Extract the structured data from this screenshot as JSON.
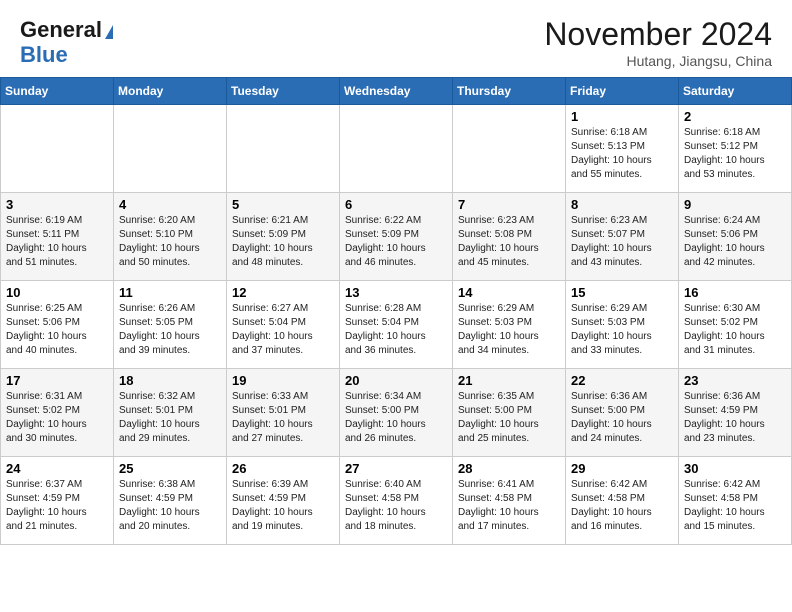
{
  "header": {
    "logo_line1": "General",
    "logo_line2": "Blue",
    "month": "November 2024",
    "location": "Hutang, Jiangsu, China"
  },
  "weekdays": [
    "Sunday",
    "Monday",
    "Tuesday",
    "Wednesday",
    "Thursday",
    "Friday",
    "Saturday"
  ],
  "weeks": [
    [
      {
        "day": "",
        "info": ""
      },
      {
        "day": "",
        "info": ""
      },
      {
        "day": "",
        "info": ""
      },
      {
        "day": "",
        "info": ""
      },
      {
        "day": "",
        "info": ""
      },
      {
        "day": "1",
        "info": "Sunrise: 6:18 AM\nSunset: 5:13 PM\nDaylight: 10 hours\nand 55 minutes."
      },
      {
        "day": "2",
        "info": "Sunrise: 6:18 AM\nSunset: 5:12 PM\nDaylight: 10 hours\nand 53 minutes."
      }
    ],
    [
      {
        "day": "3",
        "info": "Sunrise: 6:19 AM\nSunset: 5:11 PM\nDaylight: 10 hours\nand 51 minutes."
      },
      {
        "day": "4",
        "info": "Sunrise: 6:20 AM\nSunset: 5:10 PM\nDaylight: 10 hours\nand 50 minutes."
      },
      {
        "day": "5",
        "info": "Sunrise: 6:21 AM\nSunset: 5:09 PM\nDaylight: 10 hours\nand 48 minutes."
      },
      {
        "day": "6",
        "info": "Sunrise: 6:22 AM\nSunset: 5:09 PM\nDaylight: 10 hours\nand 46 minutes."
      },
      {
        "day": "7",
        "info": "Sunrise: 6:23 AM\nSunset: 5:08 PM\nDaylight: 10 hours\nand 45 minutes."
      },
      {
        "day": "8",
        "info": "Sunrise: 6:23 AM\nSunset: 5:07 PM\nDaylight: 10 hours\nand 43 minutes."
      },
      {
        "day": "9",
        "info": "Sunrise: 6:24 AM\nSunset: 5:06 PM\nDaylight: 10 hours\nand 42 minutes."
      }
    ],
    [
      {
        "day": "10",
        "info": "Sunrise: 6:25 AM\nSunset: 5:06 PM\nDaylight: 10 hours\nand 40 minutes."
      },
      {
        "day": "11",
        "info": "Sunrise: 6:26 AM\nSunset: 5:05 PM\nDaylight: 10 hours\nand 39 minutes."
      },
      {
        "day": "12",
        "info": "Sunrise: 6:27 AM\nSunset: 5:04 PM\nDaylight: 10 hours\nand 37 minutes."
      },
      {
        "day": "13",
        "info": "Sunrise: 6:28 AM\nSunset: 5:04 PM\nDaylight: 10 hours\nand 36 minutes."
      },
      {
        "day": "14",
        "info": "Sunrise: 6:29 AM\nSunset: 5:03 PM\nDaylight: 10 hours\nand 34 minutes."
      },
      {
        "day": "15",
        "info": "Sunrise: 6:29 AM\nSunset: 5:03 PM\nDaylight: 10 hours\nand 33 minutes."
      },
      {
        "day": "16",
        "info": "Sunrise: 6:30 AM\nSunset: 5:02 PM\nDaylight: 10 hours\nand 31 minutes."
      }
    ],
    [
      {
        "day": "17",
        "info": "Sunrise: 6:31 AM\nSunset: 5:02 PM\nDaylight: 10 hours\nand 30 minutes."
      },
      {
        "day": "18",
        "info": "Sunrise: 6:32 AM\nSunset: 5:01 PM\nDaylight: 10 hours\nand 29 minutes."
      },
      {
        "day": "19",
        "info": "Sunrise: 6:33 AM\nSunset: 5:01 PM\nDaylight: 10 hours\nand 27 minutes."
      },
      {
        "day": "20",
        "info": "Sunrise: 6:34 AM\nSunset: 5:00 PM\nDaylight: 10 hours\nand 26 minutes."
      },
      {
        "day": "21",
        "info": "Sunrise: 6:35 AM\nSunset: 5:00 PM\nDaylight: 10 hours\nand 25 minutes."
      },
      {
        "day": "22",
        "info": "Sunrise: 6:36 AM\nSunset: 5:00 PM\nDaylight: 10 hours\nand 24 minutes."
      },
      {
        "day": "23",
        "info": "Sunrise: 6:36 AM\nSunset: 4:59 PM\nDaylight: 10 hours\nand 23 minutes."
      }
    ],
    [
      {
        "day": "24",
        "info": "Sunrise: 6:37 AM\nSunset: 4:59 PM\nDaylight: 10 hours\nand 21 minutes."
      },
      {
        "day": "25",
        "info": "Sunrise: 6:38 AM\nSunset: 4:59 PM\nDaylight: 10 hours\nand 20 minutes."
      },
      {
        "day": "26",
        "info": "Sunrise: 6:39 AM\nSunset: 4:59 PM\nDaylight: 10 hours\nand 19 minutes."
      },
      {
        "day": "27",
        "info": "Sunrise: 6:40 AM\nSunset: 4:58 PM\nDaylight: 10 hours\nand 18 minutes."
      },
      {
        "day": "28",
        "info": "Sunrise: 6:41 AM\nSunset: 4:58 PM\nDaylight: 10 hours\nand 17 minutes."
      },
      {
        "day": "29",
        "info": "Sunrise: 6:42 AM\nSunset: 4:58 PM\nDaylight: 10 hours\nand 16 minutes."
      },
      {
        "day": "30",
        "info": "Sunrise: 6:42 AM\nSunset: 4:58 PM\nDaylight: 10 hours\nand 15 minutes."
      }
    ]
  ]
}
